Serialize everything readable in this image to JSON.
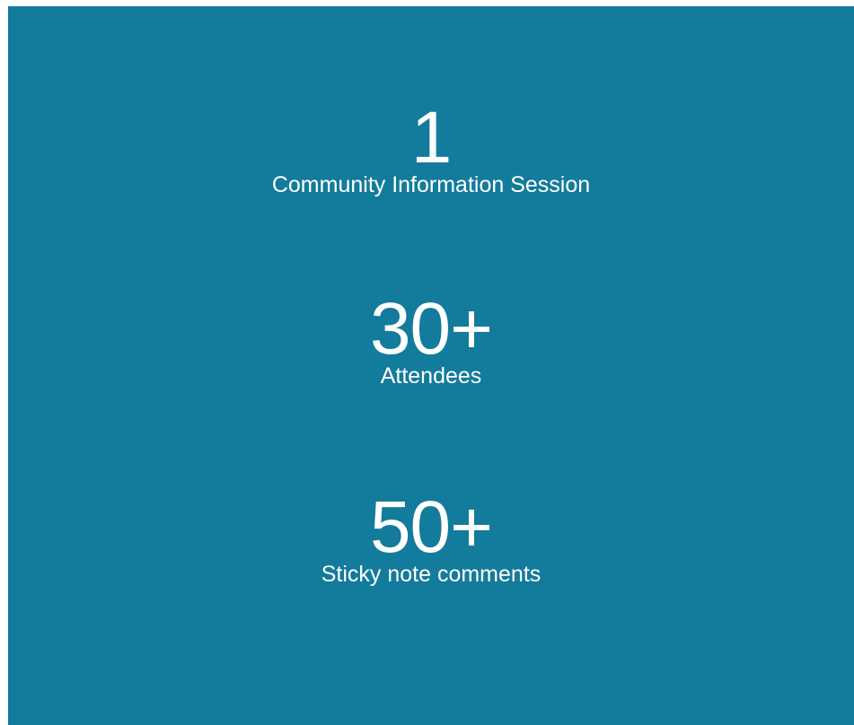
{
  "colors": {
    "panel_background": "#137b9b",
    "text": "#ffffff",
    "page_background": "#ffffff"
  },
  "stats": [
    {
      "value": "1",
      "label": "Community Information Session"
    },
    {
      "value": "30+",
      "label": "Attendees"
    },
    {
      "value": "50+",
      "label": "Sticky note comments"
    }
  ]
}
